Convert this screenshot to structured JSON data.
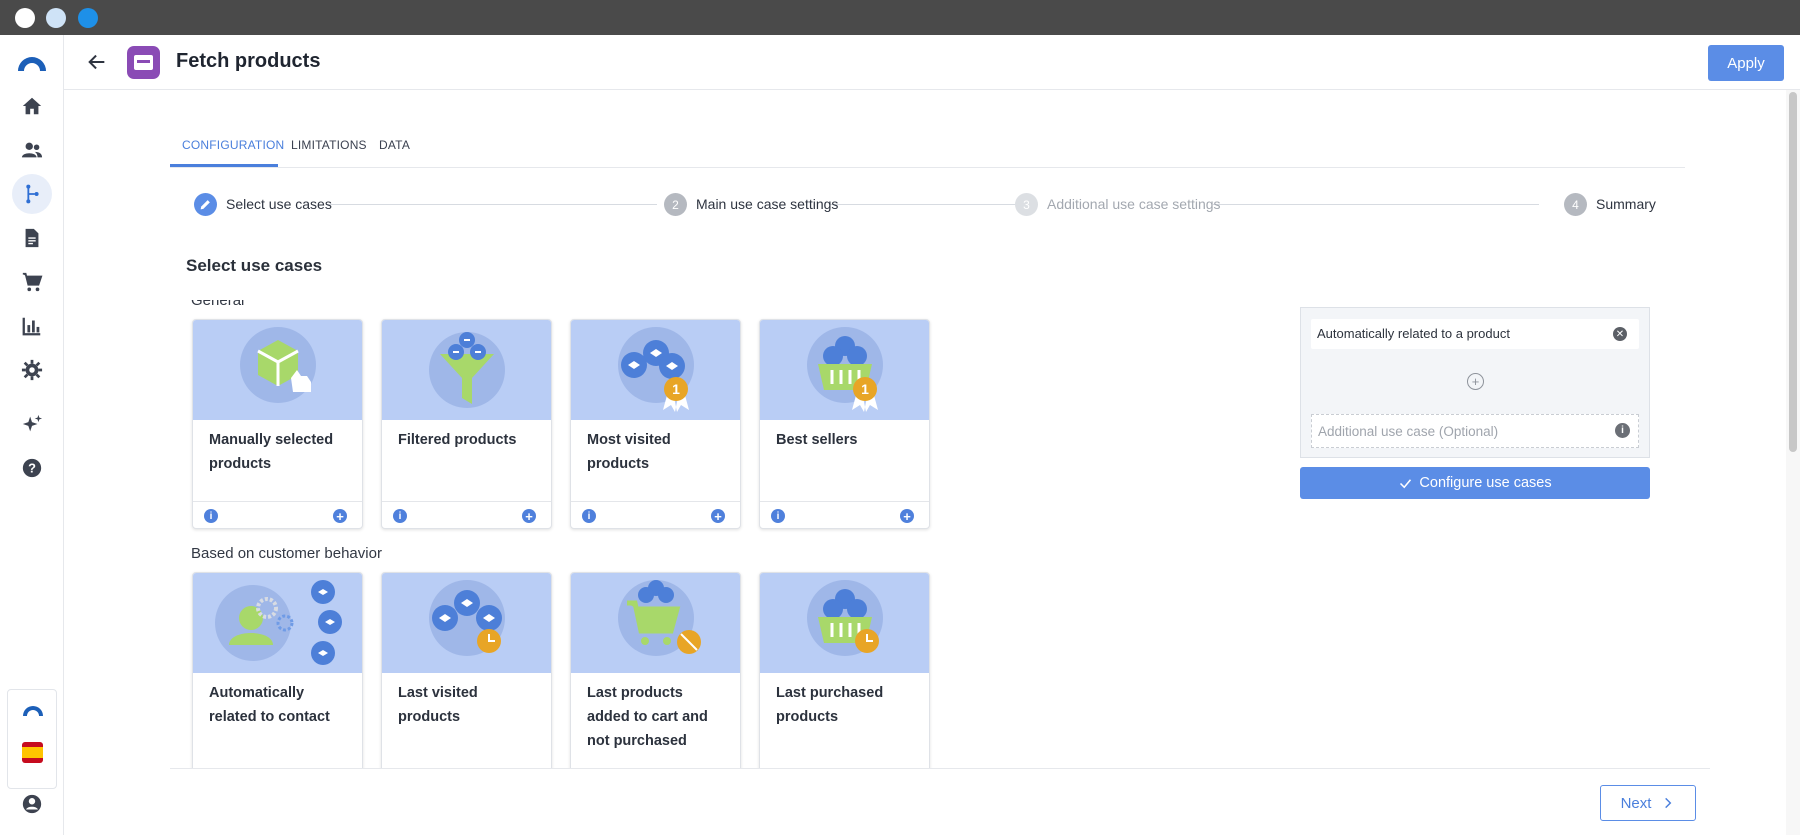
{
  "header": {
    "title": "Fetch products",
    "apply_label": "Apply"
  },
  "sidebar": {
    "items": [
      {
        "icon": "logo-icon"
      },
      {
        "icon": "home-icon"
      },
      {
        "icon": "people-icon"
      },
      {
        "icon": "flow-icon",
        "active": true
      },
      {
        "icon": "document-icon"
      },
      {
        "icon": "cart-icon"
      },
      {
        "icon": "chart-icon"
      },
      {
        "icon": "gear-icon"
      },
      {
        "icon": "sparkle-icon"
      },
      {
        "icon": "help-icon"
      },
      {
        "icon": "connectif-logo-icon"
      },
      {
        "icon": "spain-flag-icon"
      },
      {
        "icon": "account-icon"
      }
    ]
  },
  "tabs": [
    {
      "label": "CONFIGURATION",
      "active": true
    },
    {
      "label": "LIMITATIONS",
      "active": false
    },
    {
      "label": "DATA",
      "active": false
    }
  ],
  "stepper": [
    {
      "number": "1",
      "label": "Select use cases",
      "state": "current"
    },
    {
      "number": "2",
      "label": "Main use case settings",
      "state": "pending"
    },
    {
      "number": "3",
      "label": "Additional use case settings",
      "state": "disabled"
    },
    {
      "number": "4",
      "label": "Summary",
      "state": "pending"
    }
  ],
  "section_title": "Select use cases",
  "groups": [
    {
      "label": "General",
      "cards": [
        {
          "title": "Manually selected products",
          "icon": "manual-box-icon"
        },
        {
          "title": "Filtered products",
          "icon": "funnel-icon"
        },
        {
          "title": "Most visited products",
          "icon": "most-visited-icon"
        },
        {
          "title": "Best sellers",
          "icon": "basket-award-icon"
        }
      ]
    },
    {
      "label": "Based on customer behavior",
      "cards": [
        {
          "title": "Automatically related to contact",
          "icon": "contact-related-icon"
        },
        {
          "title": "Last visited products",
          "icon": "last-visited-icon"
        },
        {
          "title": "Last products added to cart and not purchased",
          "icon": "abandoned-cart-icon"
        },
        {
          "title": "Last purchased products",
          "icon": "last-purchased-icon"
        }
      ]
    }
  ],
  "use_case_panel": {
    "selected": "Automatically related to a product",
    "optional_placeholder": "Additional use case (Optional)",
    "configure_label": "Configure use cases"
  },
  "footer": {
    "next_label": "Next"
  },
  "colors": {
    "accent": "#5b8de6",
    "card_image_bg": "#b9cdf5",
    "badge_gold": "#e8a526",
    "app_icon": "#8a4bb5"
  }
}
